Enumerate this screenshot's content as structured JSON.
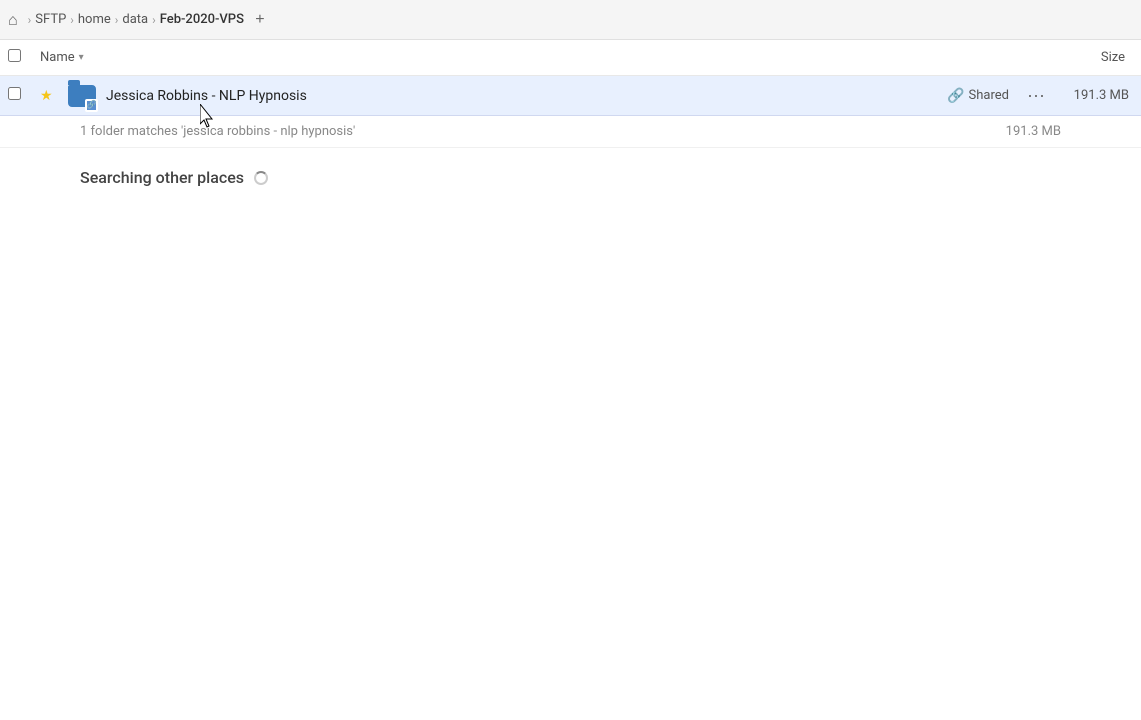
{
  "breadcrumb": {
    "items": [
      {
        "label": "SFTP",
        "id": "sftp"
      },
      {
        "label": "home",
        "id": "home"
      },
      {
        "label": "data",
        "id": "data"
      },
      {
        "label": "Feb-2020-VPS",
        "id": "feb-2020-vps",
        "current": true
      }
    ],
    "add_tab_label": "+"
  },
  "column_header": {
    "name_label": "Name",
    "size_label": "Size"
  },
  "file_row": {
    "name": "Jessica Robbins - NLP Hypnosis",
    "shared_label": "Shared",
    "more_label": "•••",
    "size": "191.3 MB"
  },
  "match_count": {
    "text": "1 folder matches 'jessica robbins - nlp hypnosis'",
    "size": "191.3 MB"
  },
  "searching_section": {
    "label": "Searching other places"
  },
  "icons": {
    "home": "⌂",
    "star": "★",
    "chain": "🔗",
    "ellipsis": "···"
  }
}
